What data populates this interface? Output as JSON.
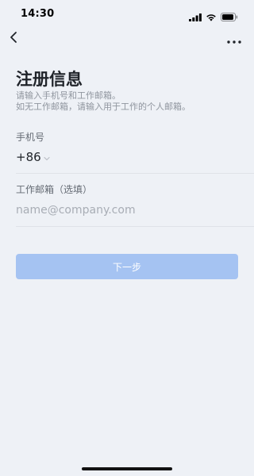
{
  "status_bar": {
    "time": "14:30",
    "icons": [
      "signal-icon",
      "wifi-icon",
      "battery-icon"
    ]
  },
  "nav": {
    "back_icon": "chevron-left-icon",
    "more_icon": "more-icon"
  },
  "page": {
    "title": "注册信息",
    "subtitle_line1": "请输入手机号和工作邮箱。",
    "subtitle_line2": "如无工作邮箱，请输入用于工作的个人邮箱。"
  },
  "phone": {
    "label": "手机号",
    "country_code": "+86"
  },
  "email": {
    "label": "工作邮箱（选填）",
    "placeholder": "name@company.com",
    "value": ""
  },
  "next_button": {
    "label": "下一步",
    "color": "#a5c3f2"
  }
}
